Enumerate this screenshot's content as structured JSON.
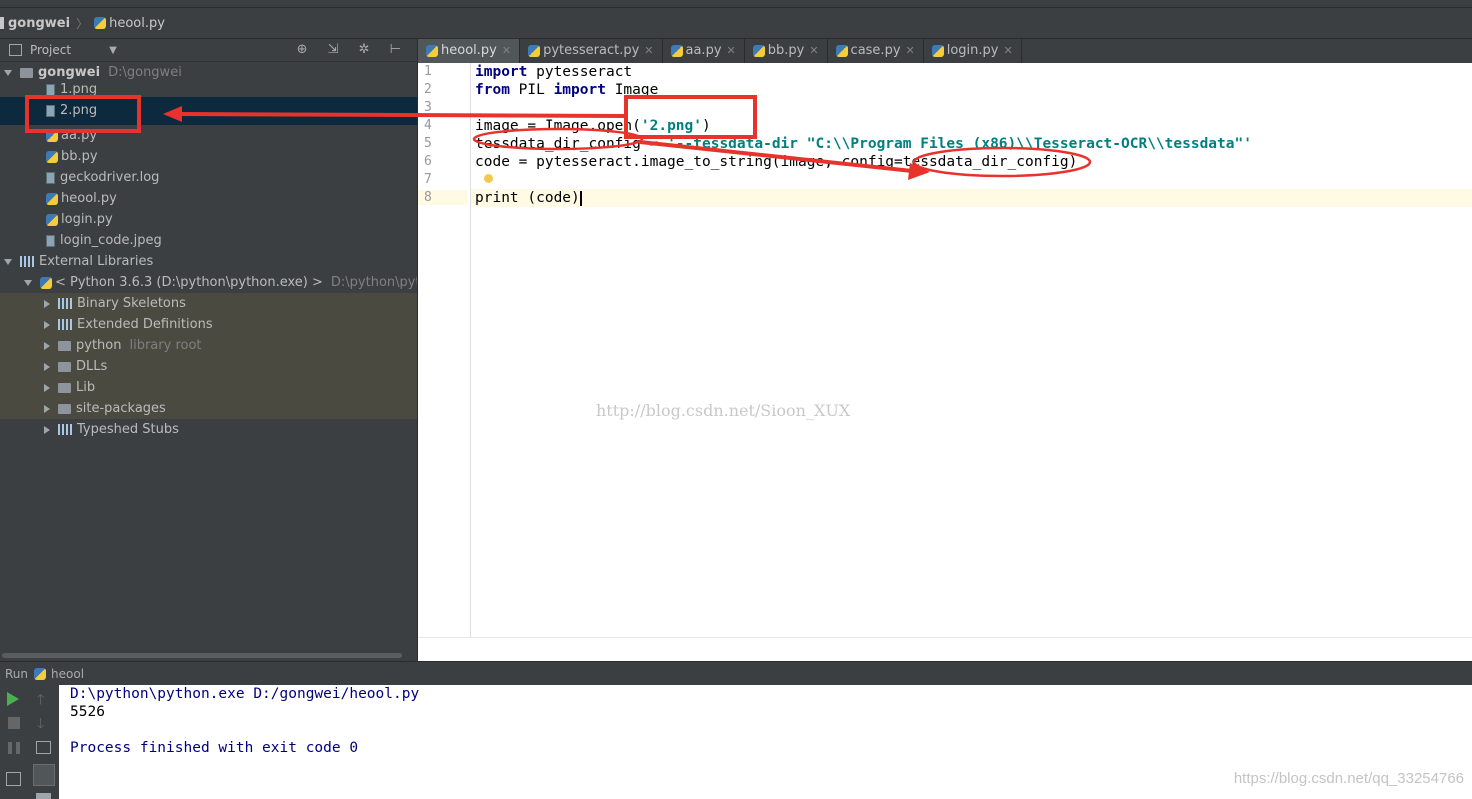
{
  "breadcrumb": {
    "project": "gongwei",
    "file": "heool.py"
  },
  "project_panel": {
    "title": "Project",
    "tools": "⊕ ⇲ ✲ ⊢",
    "root": {
      "name": "gongwei",
      "path": "D:\\gongwei"
    },
    "files": [
      "1.png",
      "2.png",
      "aa.py",
      "bb.py",
      "geckodriver.log",
      "heool.py",
      "login.py",
      "login_code.jpeg"
    ],
    "external_libraries": "External Libraries",
    "interpreter": {
      "name": "< Python 3.6.3 (D:\\python\\python.exe) >",
      "path": "D:\\python\\python.ex"
    },
    "libs": [
      {
        "name": "Binary Skeletons",
        "note": ""
      },
      {
        "name": "Extended Definitions",
        "note": ""
      },
      {
        "name": "python",
        "note": "library root"
      },
      {
        "name": "DLLs",
        "note": ""
      },
      {
        "name": "Lib",
        "note": ""
      },
      {
        "name": "site-packages",
        "note": ""
      },
      {
        "name": "Typeshed Stubs",
        "note": ""
      }
    ]
  },
  "tabs": [
    "heool.py",
    "pytesseract.py",
    "aa.py",
    "bb.py",
    "case.py",
    "login.py"
  ],
  "editor": {
    "line_numbers": [
      "1",
      "2",
      "3",
      "4",
      "5",
      "6",
      "7",
      "8"
    ],
    "l1_kw": "import",
    "l1_rest": " pytesseract",
    "l2_kw1": "from",
    "l2_mid": " PIL ",
    "l2_kw2": "import",
    "l2_rest": " Image",
    "l4_pre": "image = Image.open(",
    "l4_str": "'2.png'",
    "l4_post": ")",
    "l5_pre": "tessdata_dir_config = ",
    "l5_str": "'--tessdata-dir \"C:\\\\Program Files (x86)\\\\Tesseract-OCR\\\\tessdata\"'",
    "l6": "code = pytesseract.image_to_string(image, config=tessdata_dir_config)",
    "l8": "print (code)",
    "watermark": "http://blog.csdn.net/Sioon_XUX"
  },
  "run": {
    "label": "Run",
    "config": "heool",
    "output": [
      "D:\\python\\python.exe D:/gongwei/heool.py",
      "5526",
      "",
      "Process finished with exit code 0"
    ],
    "watermark": "https://blog.csdn.net/qq_33254766"
  },
  "colors": {
    "annotation": "#e8322c",
    "keyword": "#000080",
    "string": "#008080",
    "selected_row": "#0d293e"
  }
}
